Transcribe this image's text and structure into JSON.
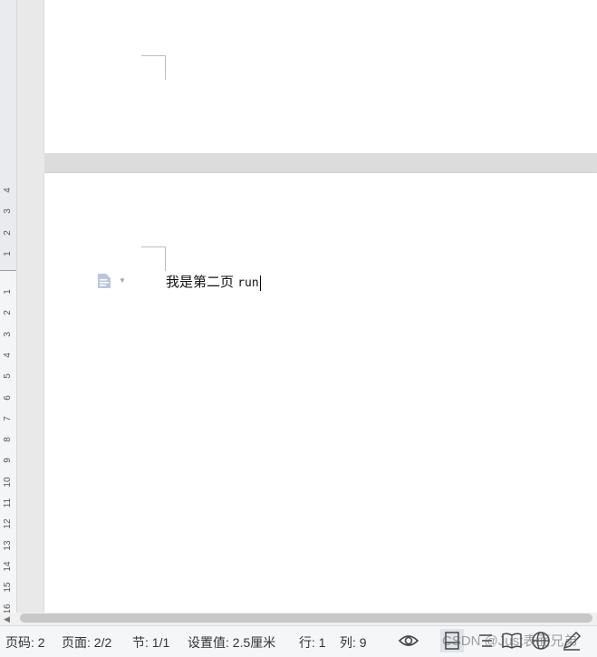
{
  "ruler": {
    "top_labels": [
      "4",
      "3",
      "2",
      "1"
    ],
    "bottom_labels": [
      "1",
      "2",
      "3",
      "4",
      "5",
      "6",
      "7",
      "8",
      "9",
      "10",
      "11",
      "12",
      "13",
      "14",
      "15",
      "16"
    ]
  },
  "document": {
    "page2_text": "我是第二页",
    "page2_text_code": "run"
  },
  "statusbar": {
    "page_number": "页码: 2",
    "page_count": "页面: 2/2",
    "section": "节: 1/1",
    "setting_value": "设置值: 2.5厘米",
    "line": "行: 1",
    "column": "列: 9"
  },
  "watermark": "CSDN @Just表面兄弟",
  "icons": [
    "paragraph-icon",
    "eye-icon",
    "page-view-icon",
    "outline-view-icon",
    "read-mode-icon",
    "web-view-icon",
    "pen-icon"
  ],
  "colors": {
    "status_bg": "#f5f6f8",
    "page_bg": "#ffffff",
    "workspace_bg": "#e3e3e3"
  }
}
